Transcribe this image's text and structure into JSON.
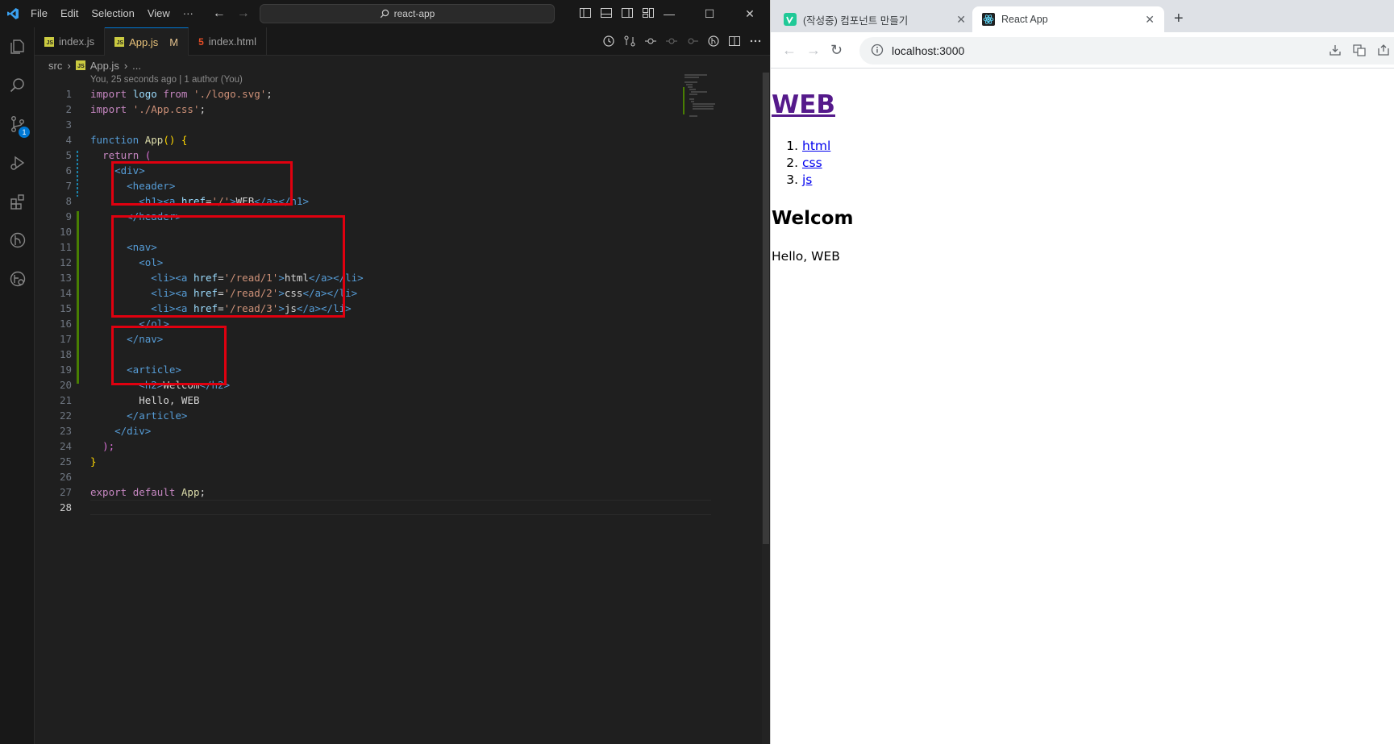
{
  "vscode": {
    "menu": [
      "File",
      "Edit",
      "Selection",
      "View",
      "···"
    ],
    "command_center": "react-app",
    "tabs": [
      {
        "label": "index.js",
        "type": "js",
        "modified": ""
      },
      {
        "label": "App.js",
        "type": "js",
        "modified": "M"
      },
      {
        "label": "index.html",
        "type": "html",
        "modified": ""
      }
    ],
    "breadcrumb": [
      "src",
      "App.js",
      "..."
    ],
    "blame": "You, 25 seconds ago | 1 author (You)",
    "scm_badge": "1",
    "line_numbers": [
      "1",
      "2",
      "3",
      "4",
      "5",
      "6",
      "7",
      "8",
      "9",
      "10",
      "11",
      "12",
      "13",
      "14",
      "15",
      "16",
      "17",
      "18",
      "19",
      "20",
      "21",
      "22",
      "23",
      "24",
      "25",
      "26",
      "27",
      "28"
    ],
    "code": {
      "l1": {
        "kw": "import",
        "var": "logo",
        "kw2": "from",
        "str": "'./logo.svg'",
        "end": ";"
      },
      "l2": {
        "kw": "import",
        "str": "'./App.css'",
        "end": ";"
      },
      "l4": {
        "kw": "function",
        "fn": "App",
        "open": "() {"
      },
      "l5": {
        "kw": "return",
        "open": "("
      },
      "l6": {
        "tag": "<div>"
      },
      "l7": {
        "tag": "<header>"
      },
      "l8": {
        "t1": "<h1><a",
        "attr": "href",
        "eq": "=",
        "str": "'/'",
        "t2": ">",
        "text": "WEB",
        "t3": "</a></h1>"
      },
      "l9": {
        "tag": "</header>"
      },
      "l11": {
        "tag": "<nav>"
      },
      "l12": {
        "tag": "<ol>"
      },
      "l13": {
        "t1": "<li><a",
        "attr": "href",
        "eq": "=",
        "str": "'/read/1'",
        "t2": ">",
        "text": "html",
        "t3": "</a></li>"
      },
      "l14": {
        "t1": "<li><a",
        "attr": "href",
        "eq": "=",
        "str": "'/read/2'",
        "t2": ">",
        "text": "css",
        "t3": "</a></li>"
      },
      "l15": {
        "t1": "<li><a",
        "attr": "href",
        "eq": "=",
        "str": "'/read/3'",
        "t2": ">",
        "text": "js",
        "t3": "</a></li>"
      },
      "l16": {
        "tag": "</ol>"
      },
      "l17": {
        "tag": "</nav>"
      },
      "l19": {
        "tag": "<article>"
      },
      "l20": {
        "t1": "<h2>",
        "text": "Welcom",
        "t3": "</h2>"
      },
      "l21": {
        "text": "Hello, WEB"
      },
      "l22": {
        "tag": "</article>"
      },
      "l23": {
        "tag": "</div>"
      },
      "l24": {
        "close": ");"
      },
      "l25": {
        "close": "}"
      },
      "l27": {
        "kw": "export",
        "kw2": "default",
        "var": "App",
        "end": ";"
      }
    },
    "colors": {
      "highlight_box": "#e0000f",
      "accent": "#0078d4"
    }
  },
  "browser": {
    "tabs": [
      {
        "title": "(작성중) 컴포넌트 만들기",
        "close": "✕"
      },
      {
        "title": "React App",
        "close": "✕"
      }
    ],
    "new_tab": "+",
    "url": "localhost:3000",
    "page": {
      "h1_link": "WEB",
      "nav_items": [
        "html",
        "css",
        "js"
      ],
      "article_title": "Welcom",
      "article_body": "Hello, WEB"
    }
  }
}
